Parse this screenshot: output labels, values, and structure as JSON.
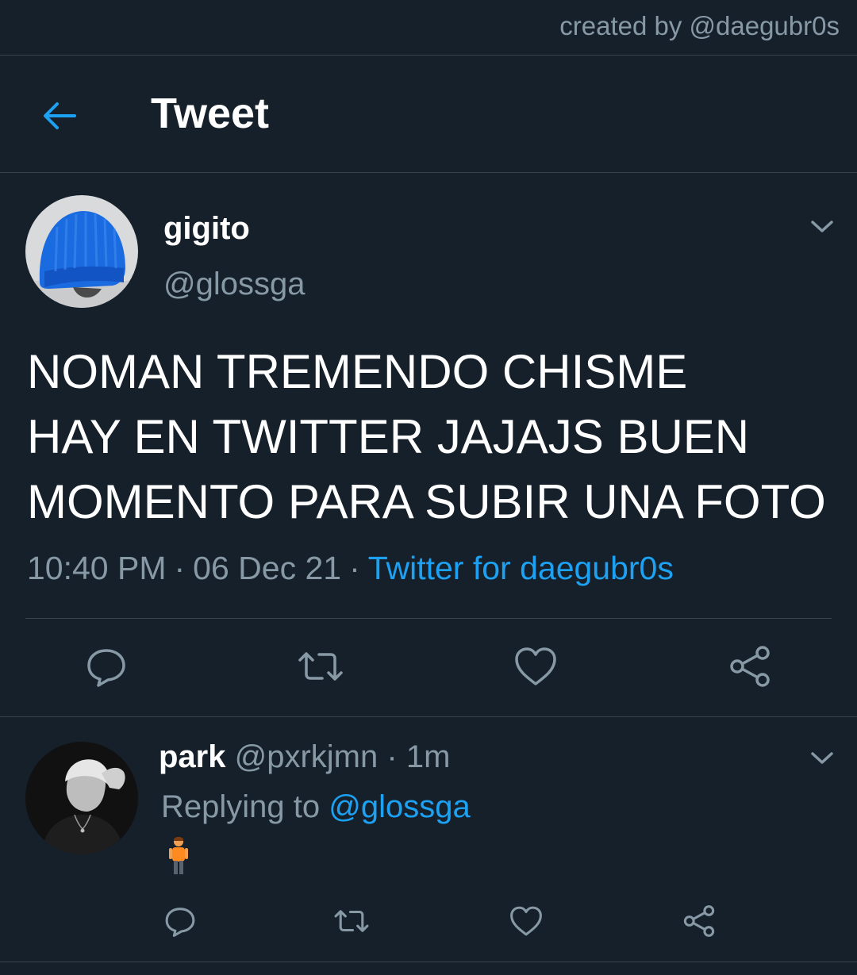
{
  "credit": "created by @daegubr0s",
  "header": {
    "back_icon": "arrow-left-icon",
    "title": "Tweet"
  },
  "tweet": {
    "author": {
      "display_name": "gigito",
      "handle": "@glossga",
      "avatar": "blue-beanie-photo"
    },
    "text": "NOMAN TREMENDO CHISME\nHAY EN TWITTER JAJAJS BUEN\nMOMENTO PARA SUBIR UNA FOTO",
    "time": "10:40 PM",
    "separator": "·",
    "date": "06 Dec 21",
    "source": "Twitter for daegubr0s",
    "actions": [
      "reply-icon",
      "retweet-icon",
      "like-icon",
      "share-icon"
    ]
  },
  "reply": {
    "display_name": "park",
    "handle": "@pxrkjmn",
    "separator": "·",
    "time": "1m",
    "replying_to_label": "Replying to",
    "replying_to_handle": "@glossga",
    "content_emoji": "person-standing-emoji",
    "actions": [
      "reply-icon",
      "retweet-icon",
      "like-icon",
      "share-icon"
    ]
  },
  "colors": {
    "background": "#15202b",
    "divider": "#38444d",
    "accent": "#1da1f2",
    "secondary_text": "#8899a6"
  }
}
